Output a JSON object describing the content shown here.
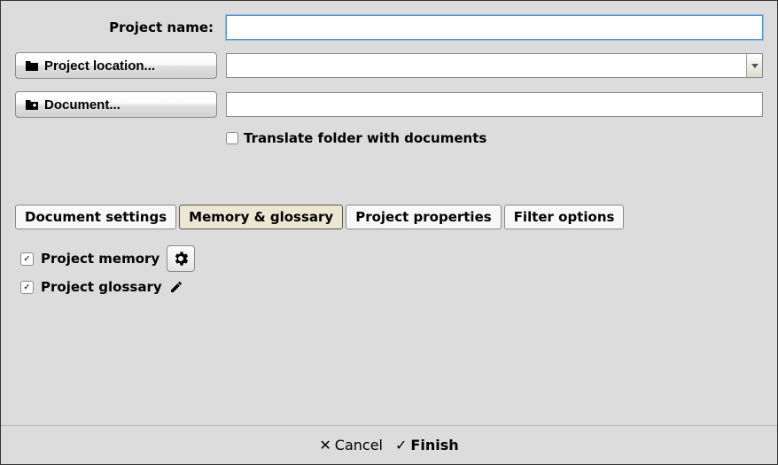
{
  "form": {
    "projectName": {
      "label": "Project name:",
      "value": ""
    },
    "projectLocation": {
      "buttonLabel": "Project location...",
      "value": ""
    },
    "document": {
      "buttonLabel": "Document...",
      "value": ""
    },
    "translateFolder": {
      "label": "Translate folder with documents",
      "checked": false
    }
  },
  "tabs": [
    {
      "label": "Document settings",
      "active": false
    },
    {
      "label": "Memory & glossary",
      "active": true
    },
    {
      "label": "Project properties",
      "active": false
    },
    {
      "label": "Filter options",
      "active": false
    }
  ],
  "memoryGlossary": {
    "projectMemory": {
      "label": "Project memory",
      "checked": true
    },
    "projectGlossary": {
      "label": "Project glossary",
      "checked": true
    }
  },
  "footer": {
    "cancel": "Cancel",
    "finish": "Finish"
  }
}
